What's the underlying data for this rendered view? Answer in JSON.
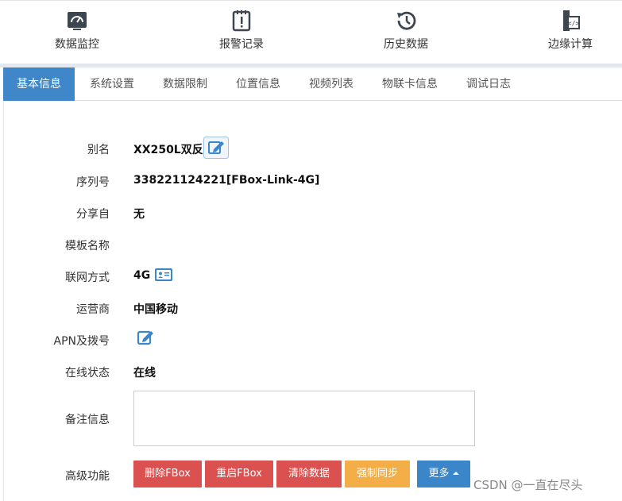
{
  "topnav": [
    {
      "label": "数据监控",
      "icon": "gauge-icon"
    },
    {
      "label": "报警记录",
      "icon": "alarm-clipboard-icon"
    },
    {
      "label": "历史数据",
      "icon": "history-icon"
    },
    {
      "label": "边缘计算",
      "icon": "edge-code-icon"
    }
  ],
  "tabs": [
    {
      "label": "基本信息",
      "active": true
    },
    {
      "label": "系统设置"
    },
    {
      "label": "数据限制"
    },
    {
      "label": "位置信息"
    },
    {
      "label": "视频列表"
    },
    {
      "label": "物联卡信息"
    },
    {
      "label": "调试日志"
    }
  ],
  "info": {
    "alias_label": "别名",
    "alias_value": "XX250L双反",
    "serial_label": "序列号",
    "serial_value": "338221124221[FBox-Link-4G]",
    "share_label": "分享自",
    "share_value": "无",
    "template_label": "模板名称",
    "template_value": "",
    "network_label": "联网方式",
    "network_value": "4G",
    "carrier_label": "运营商",
    "carrier_value": "中国移动",
    "apn_label": "APN及拨号",
    "status_label": "在线状态",
    "status_value": "在线",
    "remark_label": "备注信息",
    "remark_value": "",
    "advanced_label": "高级功能"
  },
  "buttons": {
    "delete": "删除FBox",
    "restart": "重启FBox",
    "clear": "清除数据",
    "sync": "强制同步",
    "more": "更多"
  },
  "watermark": "CSDN @一直在尽头",
  "colors": {
    "accent": "#3f87c8",
    "danger": "#db5150",
    "warning": "#f3ae48",
    "primary": "#3a86c8"
  }
}
